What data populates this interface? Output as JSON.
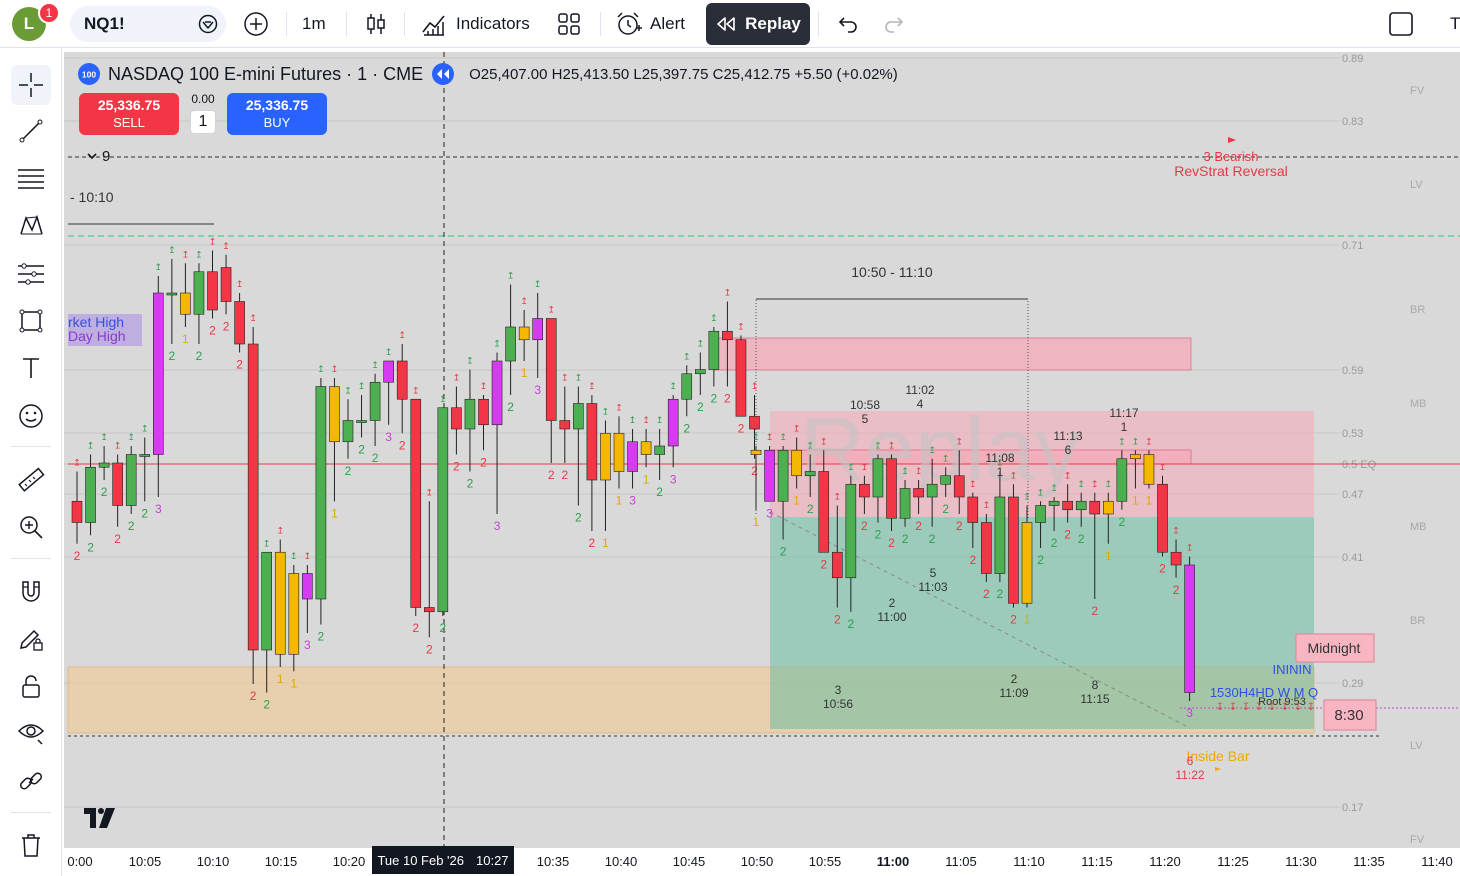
{
  "topbar": {
    "avatar_letter": "L",
    "notification_count": "1",
    "symbol": "NQ1!",
    "interval": "1m",
    "indicators_label": "Indicators",
    "alert_label": "Alert",
    "replay_label": "Replay",
    "cut_label": "T"
  },
  "legend": {
    "badge": "100",
    "title": "NASDAQ 100 E-mini Futures · 1 · CME",
    "ohlc": "O25,407.00  H25,413.50  L25,397.75  C25,412.75  +5.50 (+0.02%)"
  },
  "trade": {
    "sell_price": "25,336.75",
    "sell_label": "SELL",
    "buy_price": "25,336.75",
    "buy_label": "BUY",
    "spread": "0.00",
    "quantity": "1"
  },
  "collapse_label": "9",
  "crosshair_time": {
    "date": "Tue 10 Feb '26",
    "time": "10:27"
  },
  "colors": {
    "background": "#d9d9d9",
    "bull": "#4caf50",
    "bear": "#f23645",
    "inside": "#f5b800",
    "outside": "#d63cef",
    "box_red": "#f7a8b8",
    "box_teal": "#6cbfa3",
    "box_orange": "#f5c78a"
  },
  "chart_data": {
    "type": "candlestick",
    "symbol": "NQ1!",
    "x_ticks": [
      "0:00",
      "10:05",
      "10:10",
      "10:15",
      "10:20",
      "10:25",
      "10:30",
      "10:35",
      "10:40",
      "10:45",
      "10:50",
      "10:55",
      "11:00",
      "11:05",
      "11:10",
      "11:15",
      "11:20",
      "11:25",
      "11:30",
      "11:35",
      "11:40"
    ],
    "right_axis_ticks": [
      "0.89",
      "0.83",
      "0.71",
      "0.59",
      "0.53",
      "0.5 EQ",
      "0.47",
      "0.41",
      "0.29",
      "0.17"
    ],
    "right_axis_zone_labels": [
      "FV",
      "LV",
      "BR",
      "MB",
      "MB",
      "BR",
      "LV",
      "FV"
    ],
    "annotations": {
      "range_label": "10:50 - 11:10",
      "bearish_signal": "3 Bearish",
      "revstrat": "RevStrat Reversal",
      "market_high": "rket High",
      "day_high": "Day High",
      "time_1010": "- 10:10",
      "midnight": "Midnight",
      "time_830": "8:30",
      "ininin": "INININ",
      "htf": "1530H4HD W M Q",
      "root": "Root 9:53",
      "inside_bar": "Inside Bar",
      "pivot_labels": [
        {
          "num": "5",
          "time": "10:58"
        },
        {
          "num": "4",
          "time": "11:02"
        },
        {
          "num": "1",
          "time": "11:08"
        },
        {
          "num": "6",
          "time": "11:13"
        },
        {
          "num": "1",
          "time": "11:17"
        },
        {
          "num": "5",
          "time": "11:03"
        },
        {
          "num": "2",
          "time": "11:00"
        },
        {
          "num": "3",
          "time": "10:56"
        },
        {
          "num": "2",
          "time": "11:09"
        },
        {
          "num": "8",
          "time": "11:15"
        },
        {
          "num": "6",
          "time": "11:22"
        }
      ]
    },
    "watermark": "Replay",
    "candles": [
      {
        "o": 55,
        "h": 62,
        "l": 45,
        "c": 50,
        "s": "2"
      },
      {
        "o": 50,
        "h": 66,
        "l": 47,
        "c": 63,
        "s": "2"
      },
      {
        "o": 63,
        "h": 68,
        "l": 60,
        "c": 64,
        "s": "2"
      },
      {
        "o": 64,
        "h": 66,
        "l": 49,
        "c": 54,
        "s": "2"
      },
      {
        "o": 54,
        "h": 68,
        "l": 52,
        "c": 66,
        "s": "2"
      },
      {
        "o": 66,
        "h": 70,
        "l": 55,
        "c": 66,
        "s": "2"
      },
      {
        "o": 66,
        "h": 108,
        "l": 56,
        "c": 104,
        "s": "3"
      },
      {
        "o": 104,
        "h": 112,
        "l": 92,
        "c": 104,
        "s": "2"
      },
      {
        "o": 104,
        "h": 111,
        "l": 96,
        "c": 99,
        "s": "1"
      },
      {
        "o": 99,
        "h": 111,
        "l": 92,
        "c": 109,
        "s": "2"
      },
      {
        "o": 109,
        "h": 114,
        "l": 98,
        "c": 100,
        "s": "2"
      },
      {
        "o": 110,
        "h": 113,
        "l": 99,
        "c": 102,
        "s": "2"
      },
      {
        "o": 102,
        "h": 104,
        "l": 90,
        "c": 92,
        "s": "2"
      },
      {
        "o": 92,
        "h": 96,
        "l": 12,
        "c": 20,
        "s": "2"
      },
      {
        "o": 20,
        "h": 42,
        "l": 10,
        "c": 43,
        "s": "2"
      },
      {
        "o": 43,
        "h": 46,
        "l": 16,
        "c": 19,
        "s": "1"
      },
      {
        "o": 19,
        "h": 40,
        "l": 15,
        "c": 38,
        "s": "1"
      },
      {
        "o": 38,
        "h": 40,
        "l": 24,
        "c": 32,
        "s": "3"
      },
      {
        "o": 32,
        "h": 84,
        "l": 26,
        "c": 82,
        "s": "2"
      },
      {
        "o": 82,
        "h": 84,
        "l": 55,
        "c": 69,
        "s": "1"
      },
      {
        "o": 69,
        "h": 79,
        "l": 65,
        "c": 74,
        "s": "2"
      },
      {
        "o": 74,
        "h": 80,
        "l": 70,
        "c": 74,
        "s": "2"
      },
      {
        "o": 74,
        "h": 85,
        "l": 68,
        "c": 83,
        "s": "2"
      },
      {
        "o": 83,
        "h": 88,
        "l": 73,
        "c": 88,
        "s": "3"
      },
      {
        "o": 88,
        "h": 92,
        "l": 71,
        "c": 79,
        "s": "2"
      },
      {
        "o": 79,
        "h": 78,
        "l": 28,
        "c": 30,
        "s": "2"
      },
      {
        "o": 30,
        "h": 55,
        "l": 23,
        "c": 29,
        "s": "2"
      },
      {
        "o": 29,
        "h": 75,
        "l": 28,
        "c": 77,
        "s": "2"
      },
      {
        "o": 77,
        "h": 82,
        "l": 66,
        "c": 72,
        "s": "2"
      },
      {
        "o": 72,
        "h": 86,
        "l": 62,
        "c": 79,
        "s": "2"
      },
      {
        "o": 79,
        "h": 80,
        "l": 67,
        "c": 73,
        "s": "2"
      },
      {
        "o": 73,
        "h": 90,
        "l": 52,
        "c": 88,
        "s": "3"
      },
      {
        "o": 88,
        "h": 106,
        "l": 80,
        "c": 96,
        "s": "2"
      },
      {
        "o": 96,
        "h": 100,
        "l": 88,
        "c": 93,
        "s": "1"
      },
      {
        "o": 93,
        "h": 104,
        "l": 84,
        "c": 98,
        "s": "3"
      },
      {
        "o": 98,
        "h": 91,
        "l": 64,
        "c": 74,
        "s": "2"
      },
      {
        "o": 74,
        "h": 82,
        "l": 64,
        "c": 72,
        "s": "2"
      },
      {
        "o": 72,
        "h": 82,
        "l": 54,
        "c": 78,
        "s": "2"
      },
      {
        "o": 78,
        "h": 80,
        "l": 48,
        "c": 60,
        "s": "2"
      },
      {
        "o": 60,
        "h": 74,
        "l": 48,
        "c": 71,
        "s": "1"
      },
      {
        "o": 71,
        "h": 75,
        "l": 58,
        "c": 62,
        "s": "1"
      },
      {
        "o": 62,
        "h": 72,
        "l": 58,
        "c": 69,
        "s": "3"
      },
      {
        "o": 69,
        "h": 72,
        "l": 63,
        "c": 66,
        "s": "1"
      },
      {
        "o": 66,
        "h": 72,
        "l": 60,
        "c": 68,
        "s": "2"
      },
      {
        "o": 68,
        "h": 80,
        "l": 63,
        "c": 79,
        "s": "3"
      },
      {
        "o": 79,
        "h": 87,
        "l": 75,
        "c": 85,
        "s": "2"
      },
      {
        "o": 85,
        "h": 90,
        "l": 80,
        "c": 86,
        "s": "2"
      },
      {
        "o": 86,
        "h": 96,
        "l": 82,
        "c": 95,
        "s": "2"
      },
      {
        "o": 95,
        "h": 102,
        "l": 82,
        "c": 93,
        "s": "2"
      },
      {
        "o": 93,
        "h": 94,
        "l": 78,
        "c": 75,
        "s": "2"
      },
      {
        "o": 75,
        "h": 80,
        "l": 65,
        "c": 72,
        "s": "2"
      }
    ],
    "candles_right": [
      {
        "o": 66,
        "h": 68,
        "l": 53,
        "c": 67,
        "s": "1"
      },
      {
        "o": 67,
        "h": 68,
        "l": 60,
        "c": 55,
        "s": "3"
      },
      {
        "o": 55,
        "h": 68,
        "l": 46,
        "c": 67,
        "s": "2"
      },
      {
        "o": 67,
        "h": 70,
        "l": 58,
        "c": 61,
        "s": "1"
      },
      {
        "o": 61,
        "h": 66,
        "l": 56,
        "c": 62,
        "s": "2"
      },
      {
        "o": 62,
        "h": 67,
        "l": 46,
        "c": 43,
        "s": "2"
      },
      {
        "o": 43,
        "h": 54,
        "l": 30,
        "c": 37,
        "s": "2"
      },
      {
        "o": 37,
        "h": 61,
        "l": 29,
        "c": 59,
        "s": "2"
      },
      {
        "o": 59,
        "h": 61,
        "l": 52,
        "c": 56,
        "s": "2"
      },
      {
        "o": 56,
        "h": 66,
        "l": 50,
        "c": 65,
        "s": "2"
      },
      {
        "o": 65,
        "h": 66,
        "l": 48,
        "c": 51,
        "s": "2"
      },
      {
        "o": 51,
        "h": 60,
        "l": 49,
        "c": 58,
        "s": "2"
      },
      {
        "o": 58,
        "h": 60,
        "l": 52,
        "c": 56,
        "s": "2"
      },
      {
        "o": 56,
        "h": 65,
        "l": 49,
        "c": 59,
        "s": "2"
      },
      {
        "o": 59,
        "h": 63,
        "l": 56,
        "c": 61,
        "s": "2"
      },
      {
        "o": 61,
        "h": 67,
        "l": 52,
        "c": 56,
        "s": "2"
      },
      {
        "o": 56,
        "h": 57,
        "l": 44,
        "c": 50,
        "s": "2"
      },
      {
        "o": 50,
        "h": 52,
        "l": 36,
        "c": 38,
        "s": "2"
      },
      {
        "o": 38,
        "h": 62,
        "l": 36,
        "c": 56,
        "s": "2"
      },
      {
        "o": 56,
        "h": 59,
        "l": 30,
        "c": 31,
        "s": "2"
      },
      {
        "o": 31,
        "h": 54,
        "l": 30,
        "c": 50,
        "s": "1"
      },
      {
        "o": 50,
        "h": 55,
        "l": 44,
        "c": 54,
        "s": "2"
      },
      {
        "o": 54,
        "h": 56,
        "l": 48,
        "c": 55,
        "s": "2"
      },
      {
        "o": 55,
        "h": 59,
        "l": 50,
        "c": 53,
        "s": "2"
      },
      {
        "o": 53,
        "h": 57,
        "l": 49,
        "c": 55,
        "s": "2"
      },
      {
        "o": 55,
        "h": 57,
        "l": 32,
        "c": 52,
        "s": "2"
      },
      {
        "o": 52,
        "h": 57,
        "l": 45,
        "c": 55,
        "s": "1"
      },
      {
        "o": 55,
        "h": 67,
        "l": 53,
        "c": 65,
        "s": "2"
      },
      {
        "o": 65,
        "h": 67,
        "l": 58,
        "c": 66,
        "s": "1"
      },
      {
        "o": 66,
        "h": 67,
        "l": 58,
        "c": 59,
        "s": "1"
      },
      {
        "o": 59,
        "h": 61,
        "l": 42,
        "c": 43,
        "s": "2"
      },
      {
        "o": 43,
        "h": 46,
        "l": 37,
        "c": 40,
        "s": "2"
      },
      {
        "o": 40,
        "h": 42,
        "l": 8,
        "c": 10,
        "s": "3"
      }
    ]
  }
}
